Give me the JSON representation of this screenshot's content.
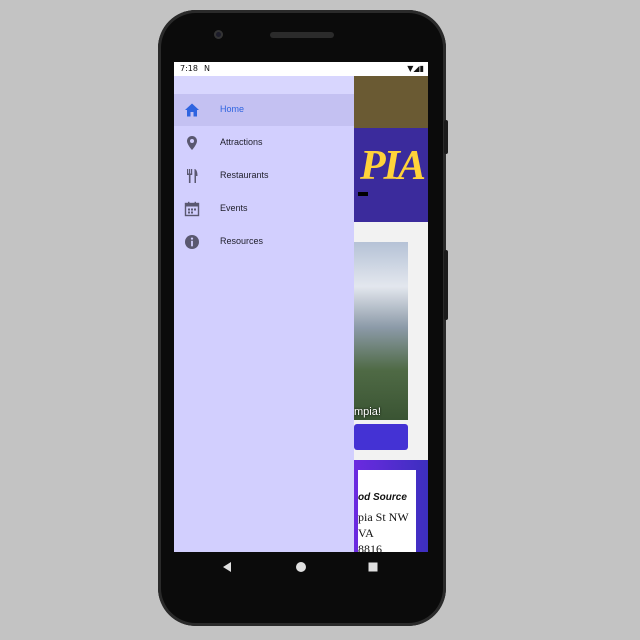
{
  "status_bar": {
    "time": "7:18",
    "left_icons": "N",
    "right_icons": "▼◢▮"
  },
  "background_app": {
    "banner_title": "PIA",
    "photo_caption": "mpia!",
    "card": {
      "line1": "od Source",
      "line2": "pia St NW",
      "line3": "VA",
      "line4": "8816"
    }
  },
  "drawer": {
    "items": [
      {
        "label": "Home",
        "icon": "home-icon",
        "active": true
      },
      {
        "label": "Attractions",
        "icon": "location-pin-icon",
        "active": false
      },
      {
        "label": "Restaurants",
        "icon": "fork-knife-icon",
        "active": false
      },
      {
        "label": "Events",
        "icon": "calendar-icon",
        "active": false
      },
      {
        "label": "Resources",
        "icon": "info-icon",
        "active": false
      }
    ]
  },
  "colors": {
    "drawer_bg": "#d2cffe",
    "active_item_bg": "#c4c1f2",
    "active_text": "#2f64e0",
    "icon_color": "#5a5870"
  },
  "system_nav": {
    "back": "back-icon",
    "home": "home-circle-icon",
    "recents": "recents-icon"
  }
}
